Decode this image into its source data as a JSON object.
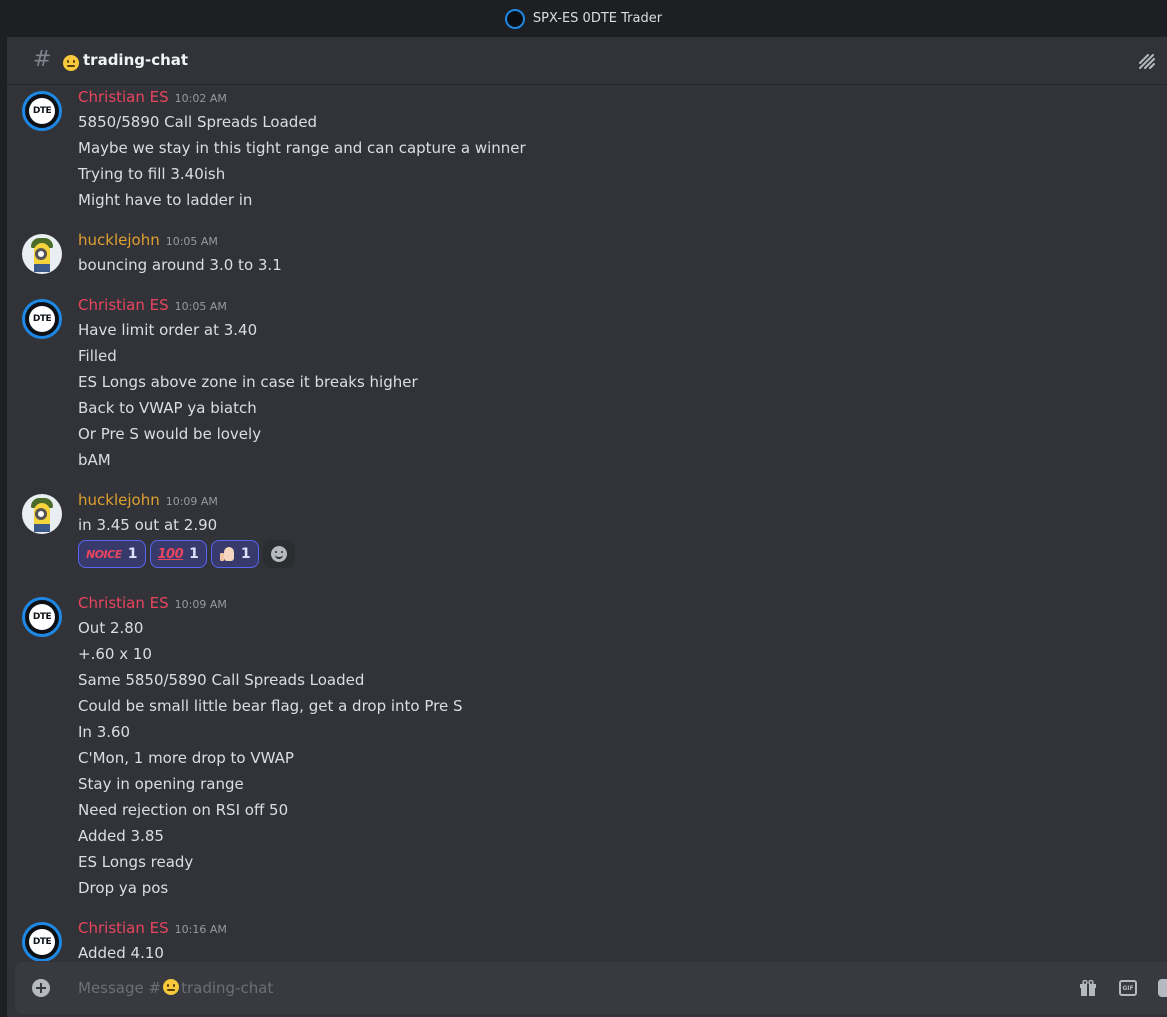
{
  "window": {
    "title": "SPX-ES 0DTE Trader"
  },
  "channel": {
    "name": "trading-chat"
  },
  "composer": {
    "placeholder_prefix": "Message #",
    "placeholder_channel": "trading-chat"
  },
  "messages": [
    {
      "author": "Christian ES",
      "time": "10:02 AM",
      "lines": [
        "5850/5890 Call Spreads Loaded",
        "Maybe we stay in this tight range and can capture a winner",
        "Trying to fill 3.40ish",
        "Might have to ladder in"
      ]
    },
    {
      "author": "hucklejohn",
      "time": "10:05 AM",
      "lines": [
        "bouncing around 3.0 to 3.1"
      ]
    },
    {
      "author": "Christian ES",
      "time": "10:05 AM",
      "lines": [
        "Have limit order at 3.40",
        "Filled",
        "ES Longs above zone in case it breaks higher",
        "Back to VWAP ya biatch",
        "Or Pre S would be lovely",
        "bAM"
      ]
    },
    {
      "author": "hucklejohn",
      "time": "10:09 AM",
      "lines": [
        "in 3.45 out at 2.90"
      ],
      "reactions": [
        {
          "emoji": "noice",
          "glyph": "NOICE",
          "count": "1"
        },
        {
          "emoji": "100",
          "glyph": "100",
          "count": "1"
        },
        {
          "emoji": "thumbs-up",
          "glyph": "",
          "count": "1"
        }
      ]
    },
    {
      "author": "Christian ES",
      "time": "10:09 AM",
      "lines": [
        "Out 2.80",
        "+.60 x 10",
        "Same 5850/5890 Call Spreads Loaded",
        "Could be small little bear flag, get a drop into Pre S",
        "In 3.60",
        "C'Mon, 1 more drop to VWAP",
        "Stay in opening range",
        "Need rejection on RSI off 50",
        "Added 3.85",
        "ES Longs ready",
        "Drop ya pos"
      ]
    },
    {
      "author": "Christian ES",
      "time": "10:16 AM",
      "lines": [
        "Added 4.10"
      ]
    }
  ],
  "avatar_text": {
    "odte": "DTE"
  },
  "colors": {
    "christian": "#e9455f",
    "hucklejohn": "#e0a02f",
    "background": "#313338",
    "reaction_border": "#5865f2"
  }
}
